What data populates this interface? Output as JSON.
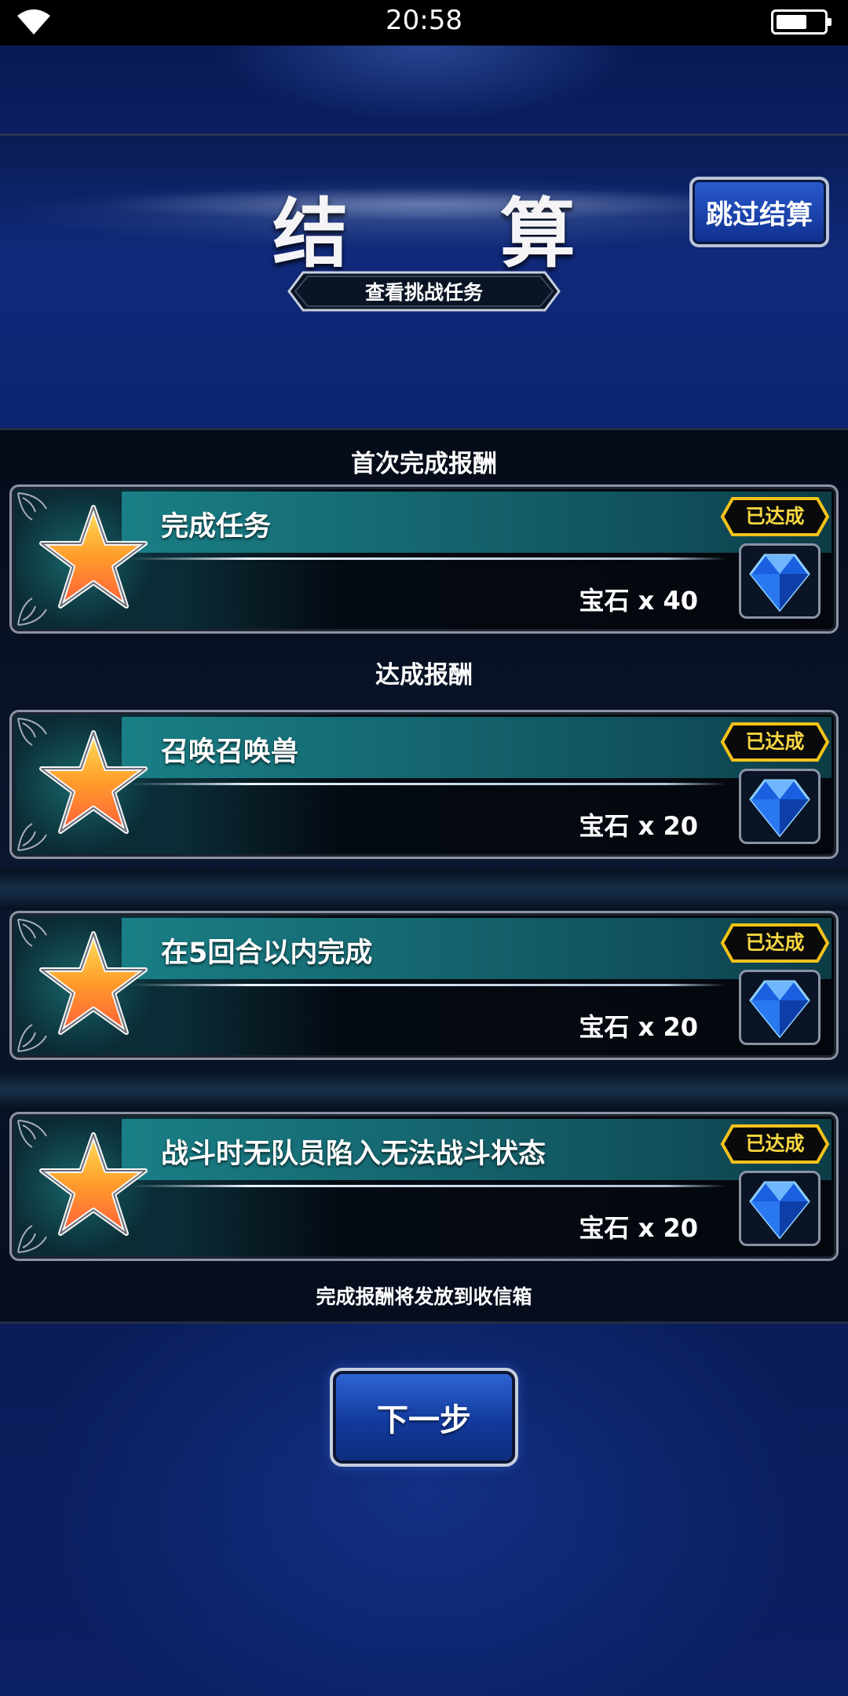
{
  "status_bar": {
    "time": "20:58"
  },
  "header": {
    "title": "结 算",
    "skip_button": "跳过结算",
    "view_challenge_button": "查看挑战任务"
  },
  "sections": {
    "first_clear": "首次完成报酬",
    "achievement": "达成报酬"
  },
  "missions": [
    {
      "title": "完成任务",
      "reward": "宝石 x 40",
      "status": "已达成"
    },
    {
      "title": "召唤召唤兽",
      "reward": "宝石 x 20",
      "status": "已达成"
    },
    {
      "title": "在5回合以内完成",
      "reward": "宝石 x 20",
      "status": "已达成"
    },
    {
      "title": "战斗时无队员陷入无法战斗状态",
      "reward": "宝石 x 20",
      "status": "已达成"
    }
  ],
  "footer_note": "完成报酬将发放到收信箱",
  "next_button": "下一步",
  "colors": {
    "badge_yellow": "#f5d642",
    "accent_blue": "#1f4fc0",
    "card_teal": "#1a7f86"
  }
}
